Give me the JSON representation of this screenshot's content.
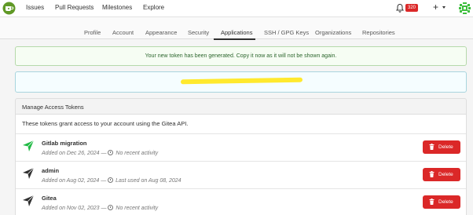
{
  "nav": {
    "items": [
      "Issues",
      "Pull Requests",
      "Milestones",
      "Explore"
    ],
    "notification_count": "320",
    "plus": "+"
  },
  "tabs": [
    {
      "label": "Profile",
      "active": false
    },
    {
      "label": "Account",
      "active": false
    },
    {
      "label": "Appearance",
      "active": false
    },
    {
      "label": "Security",
      "active": false
    },
    {
      "label": "Applications",
      "active": true
    },
    {
      "label": "SSH / GPG Keys",
      "active": false
    },
    {
      "label": "Organizations",
      "active": false
    },
    {
      "label": "Repositories",
      "active": false
    }
  ],
  "messages": {
    "success": "Your new token has been generated. Copy it now as it will not be shown again."
  },
  "tokens_section": {
    "title": "Manage Access Tokens",
    "intro": "These tokens grant access to your account using the Gitea API.",
    "delete_label": "Delete",
    "tokens": [
      {
        "name": "Gitlab migration",
        "added": "Added on Dec 26, 2024",
        "activity": "No recent activity",
        "icon": "send-icon",
        "icon_color": "#21ba45"
      },
      {
        "name": "admin",
        "added": "Added on Aug 02, 2024",
        "activity": "Last used on Aug 08, 2024",
        "icon": "send-icon",
        "icon_color": "#303030"
      },
      {
        "name": "Gitea",
        "added": "Added on Nov 02, 2023",
        "activity": "No recent activity",
        "icon": "send-icon",
        "icon_color": "#303030"
      }
    ]
  },
  "colors": {
    "accent": "#609926",
    "danger": "#db2828",
    "success_bg": "#f6fdf3",
    "info_bg": "#f5fdff"
  }
}
